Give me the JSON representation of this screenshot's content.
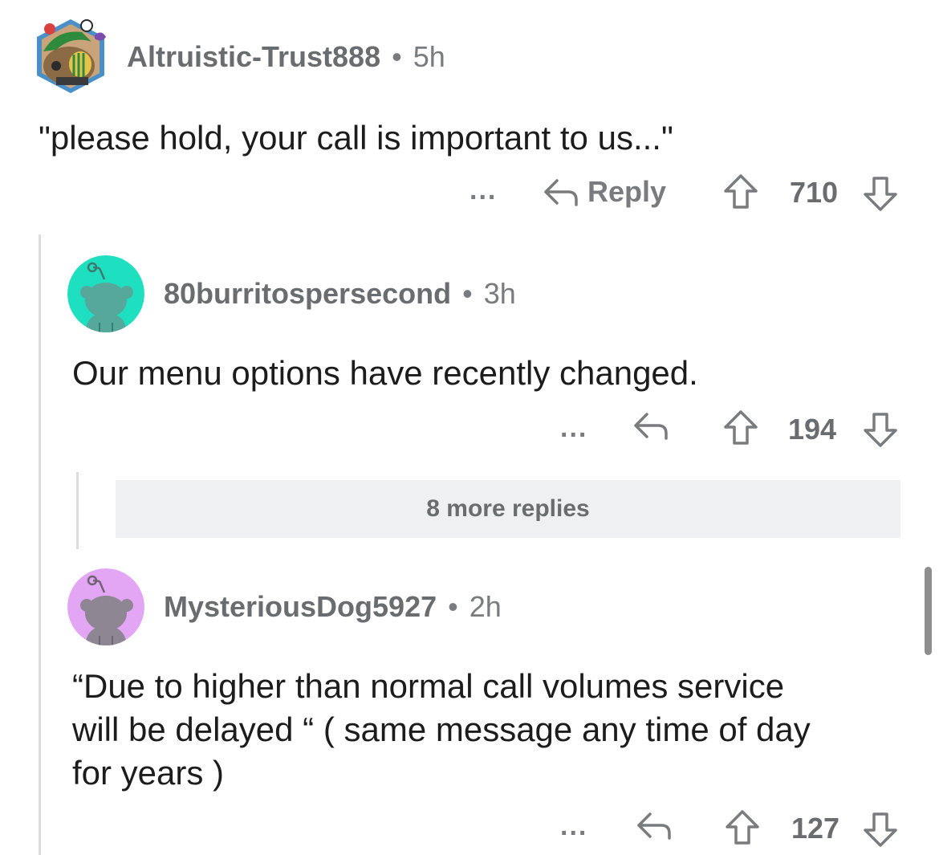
{
  "comments": [
    {
      "username": "Altruistic-Trust888",
      "age": "5h",
      "body": "\"please hold, your call is important to us...\"",
      "reply_label": "Reply",
      "votes": "710",
      "more_label": "...",
      "avatar_icon": "custom-snoo-avatar-icon"
    },
    {
      "username": "80burritospersecond",
      "age": "3h",
      "body": "Our menu options have recently changed.",
      "votes": "194",
      "more_label": "...",
      "avatar_color": "#1ee0c0",
      "avatar_icon": "snoo-avatar-icon"
    },
    {
      "username": "MysteriousDog5927",
      "age": "2h",
      "body_lines": [
        "“Due to higher than normal call volumes service",
        "will be delayed “ ( same message any time of day",
        "for years )"
      ],
      "votes": "127",
      "more_label": "...",
      "avatar_color": "#e2a6f5",
      "avatar_icon": "snoo-avatar-icon"
    }
  ],
  "more_replies_label": "8 more replies",
  "separator": "•",
  "colors": {
    "meta_text": "#787c7e",
    "body_text": "#1c1c1c",
    "more_replies_bg": "#eef0f1"
  }
}
